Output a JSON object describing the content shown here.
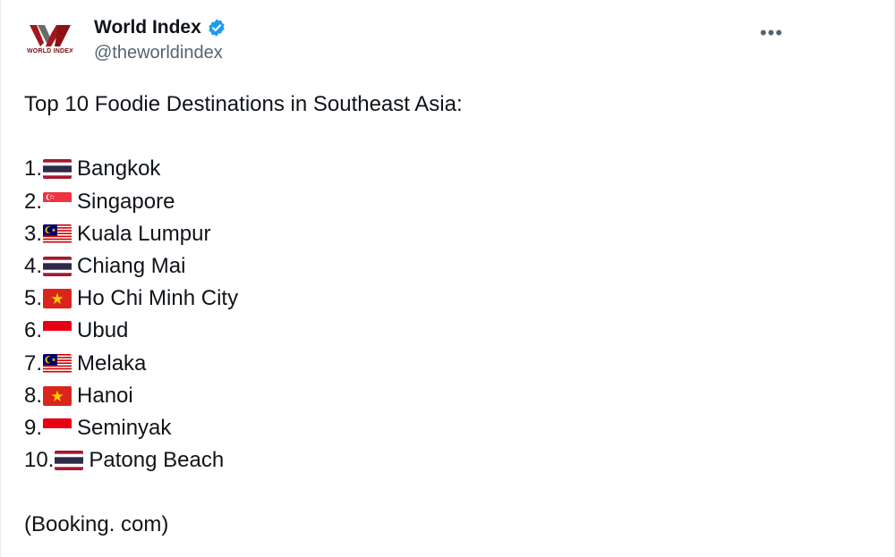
{
  "account": {
    "display_name": "World Index",
    "handle": "@theworldindex",
    "avatar_text": "WORLD INDEX",
    "verified_icon": "verified-badge-icon"
  },
  "menu": {
    "more_icon": "more-horizontal-icon",
    "more_label": "•••"
  },
  "tweet": {
    "intro": "Top 10 Foodie Destinations in Southeast Asia:",
    "items": [
      {
        "number": "1.",
        "flag": "thailand-flag",
        "name": "Bangkok"
      },
      {
        "number": "2.",
        "flag": "singapore-flag",
        "name": "Singapore"
      },
      {
        "number": "3.",
        "flag": "malaysia-flag",
        "name": "Kuala Lumpur"
      },
      {
        "number": "4.",
        "flag": "thailand-flag",
        "name": "Chiang Mai"
      },
      {
        "number": "5.",
        "flag": "vietnam-flag",
        "name": "Ho Chi Minh City"
      },
      {
        "number": "6.",
        "flag": "indonesia-flag",
        "name": "Ubud"
      },
      {
        "number": "7.",
        "flag": "malaysia-flag",
        "name": "Melaka"
      },
      {
        "number": "8.",
        "flag": "vietnam-flag",
        "name": "Hanoi"
      },
      {
        "number": "9.",
        "flag": "indonesia-flag",
        "name": "Seminyak"
      },
      {
        "number": "10.",
        "flag": "thailand-flag",
        "name": "Patong Beach"
      }
    ],
    "source": "(Booking. com)"
  },
  "colors": {
    "text": "#0f1419",
    "secondary": "#536471",
    "verified_blue": "#1d9bf0",
    "brand_red": "#a3161b"
  }
}
